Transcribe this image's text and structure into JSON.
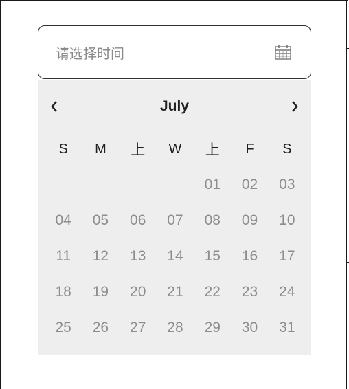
{
  "input": {
    "placeholder": "请选择时间",
    "icon": "calendar-icon"
  },
  "calendar": {
    "month": "July",
    "weekdays": [
      "S",
      "M",
      "上",
      "W",
      "上",
      "F",
      "S"
    ],
    "weeks": [
      [
        "",
        "",
        "",
        "",
        "01",
        "02",
        "03"
      ],
      [
        "04",
        "05",
        "06",
        "07",
        "08",
        "09",
        "10"
      ],
      [
        "11",
        "12",
        "13",
        "14",
        "15",
        "16",
        "17"
      ],
      [
        "18",
        "19",
        "20",
        "21",
        "22",
        "23",
        "24"
      ],
      [
        "25",
        "26",
        "27",
        "28",
        "29",
        "30",
        "31"
      ]
    ]
  },
  "colors": {
    "panel_bg": "#eeeeee",
    "day_text": "#8d8d8d",
    "border": "#333333"
  }
}
